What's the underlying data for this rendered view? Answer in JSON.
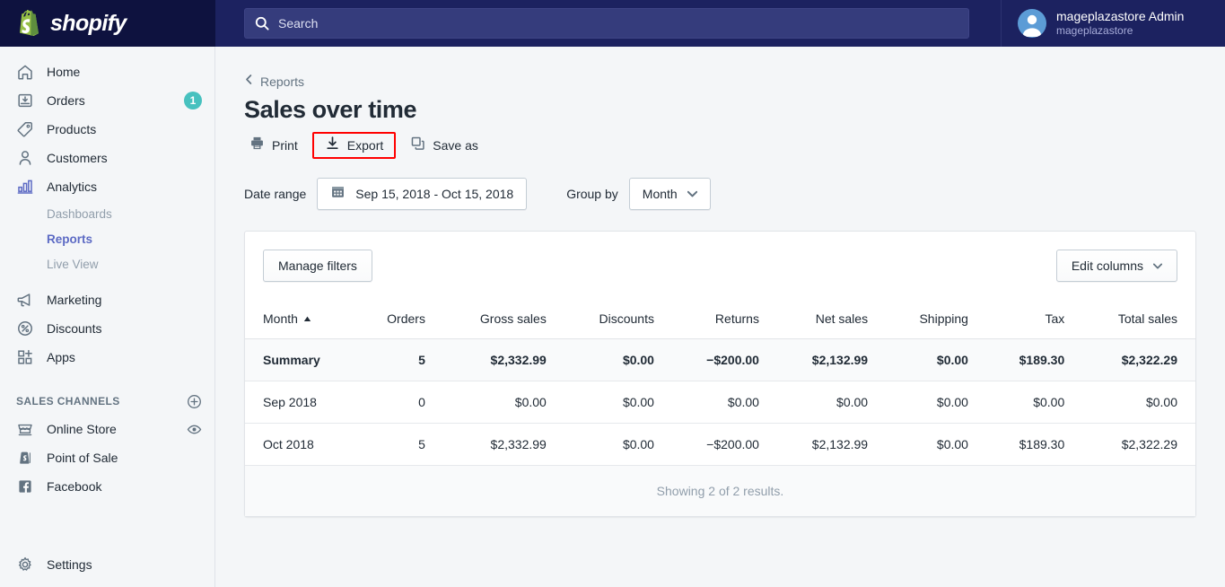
{
  "topbar": {
    "brand_name": "shopify",
    "search": {
      "placeholder": "Search",
      "icon": "search-icon"
    },
    "user": {
      "name": "mageplazastore Admin",
      "store": "mageplazastore"
    }
  },
  "sidebar": {
    "items": [
      {
        "label": "Home",
        "icon": "home-icon"
      },
      {
        "label": "Orders",
        "icon": "orders-icon",
        "badge": "1"
      },
      {
        "label": "Products",
        "icon": "products-tag-icon"
      },
      {
        "label": "Customers",
        "icon": "customers-person-icon"
      },
      {
        "label": "Analytics",
        "icon": "analytics-bars-icon",
        "active": true
      }
    ],
    "analytics_children": [
      {
        "label": "Dashboards",
        "active": false
      },
      {
        "label": "Reports",
        "active": true
      },
      {
        "label": "Live View",
        "active": false
      }
    ],
    "items_after": [
      {
        "label": "Marketing",
        "icon": "marketing-megaphone-icon"
      },
      {
        "label": "Discounts",
        "icon": "discounts-percent-icon"
      },
      {
        "label": "Apps",
        "icon": "apps-grid-plus-icon"
      }
    ],
    "sales_channels": {
      "title": "SALES CHANNELS",
      "add_icon": "plus-circle-icon",
      "items": [
        {
          "label": "Online Store",
          "icon": "online-store-icon",
          "trailing_icon": "eye-icon"
        },
        {
          "label": "Point of Sale",
          "icon": "point-of-sale-icon"
        },
        {
          "label": "Facebook",
          "icon": "facebook-icon"
        }
      ]
    },
    "settings": {
      "label": "Settings",
      "icon": "gear-icon"
    }
  },
  "main": {
    "breadcrumb": {
      "label": "Reports",
      "icon": "chevron-left-icon"
    },
    "page_title": "Sales over time",
    "actions": [
      {
        "label": "Print",
        "icon": "printer-icon",
        "highlighted": false
      },
      {
        "label": "Export",
        "icon": "download-icon",
        "highlighted": true
      },
      {
        "label": "Save as",
        "icon": "duplicate-icon",
        "highlighted": false
      }
    ],
    "controls": {
      "date_range_label": "Date range",
      "date_range_value": "Sep 15, 2018 - Oct 15, 2018",
      "date_range_icon": "calendar-icon",
      "group_by_label": "Group by",
      "group_by_value": "Month",
      "caret_icon": "chevron-down-icon"
    },
    "card": {
      "manage_filters_label": "Manage filters",
      "edit_columns_label": "Edit columns",
      "edit_columns_caret": "chevron-down-icon",
      "footer_text": "Showing 2 of 2 results."
    }
  },
  "table": {
    "sort_column": "Month",
    "sort_direction": "ascending",
    "sort_icon": "triangle-up-icon",
    "columns": [
      "Month",
      "Orders",
      "Gross sales",
      "Discounts",
      "Returns",
      "Net sales",
      "Shipping",
      "Tax",
      "Total sales"
    ],
    "rows": [
      {
        "summary": true,
        "cells": [
          "Summary",
          "5",
          "$2,332.99",
          "$0.00",
          "−$200.00",
          "$2,132.99",
          "$0.00",
          "$189.30",
          "$2,322.29"
        ]
      },
      {
        "summary": false,
        "cells": [
          "Sep 2018",
          "0",
          "$0.00",
          "$0.00",
          "$0.00",
          "$0.00",
          "$0.00",
          "$0.00",
          "$0.00"
        ]
      },
      {
        "summary": false,
        "cells": [
          "Oct 2018",
          "5",
          "$2,332.99",
          "$0.00",
          "−$200.00",
          "$2,132.99",
          "$0.00",
          "$189.30",
          "$2,322.29"
        ]
      }
    ]
  },
  "colors": {
    "brand_dark": "#0E123F",
    "topbar": "#1C2260",
    "accent_purple": "#5C6AC4",
    "badge_teal": "#47C1BF",
    "highlight_red": "#FF0000",
    "text_primary": "#212B36",
    "text_subdued": "#919EAB"
  }
}
